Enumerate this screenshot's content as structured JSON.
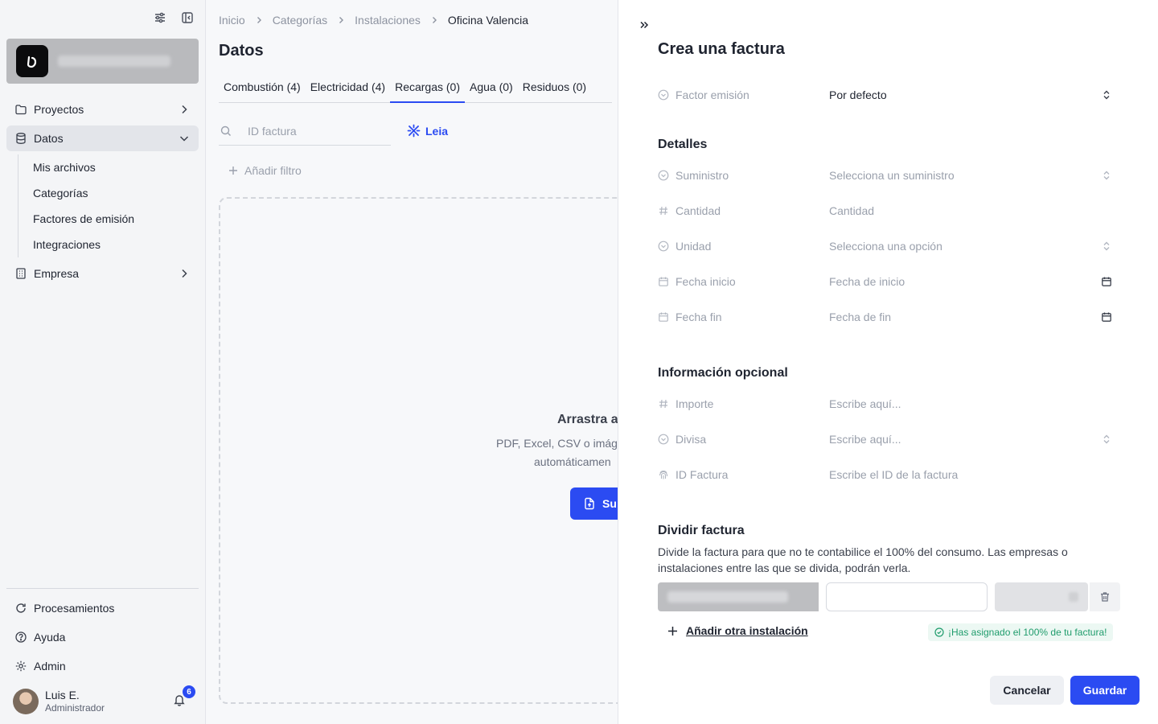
{
  "sidebar": {
    "nav": [
      {
        "label": "Proyectos",
        "icon": "folder-icon"
      },
      {
        "label": "Datos",
        "icon": "database-icon"
      },
      {
        "label": "Empresa",
        "icon": "building-icon"
      }
    ],
    "datos_sub": [
      "Mis archivos",
      "Categorías",
      "Factores de emisión",
      "Integraciones"
    ],
    "bottom": [
      {
        "label": "Procesamientos",
        "icon": "refresh-icon"
      },
      {
        "label": "Ayuda",
        "icon": "help-icon"
      },
      {
        "label": "Admin",
        "icon": "gear-icon"
      }
    ],
    "user": {
      "name": "Luis E.",
      "role": "Administrador",
      "notifications": "6"
    }
  },
  "main": {
    "breadcrumb": [
      "Inicio",
      "Categorías",
      "Instalaciones",
      "Oficina Valencia"
    ],
    "title": "Datos",
    "tabs": [
      "Combustión (4)",
      "Electricidad (4)",
      "Recargas (0)",
      "Agua (0)",
      "Residuos (0)"
    ],
    "active_tab": 2,
    "search_placeholder": "ID factura",
    "leia_label": "Leia",
    "add_filter": "Añadir filtro",
    "dropzone": {
      "title": "Arrastra a",
      "line1": "PDF, Excel, CSV o imág",
      "line2": "automáticamen",
      "button": "Su"
    }
  },
  "drawer": {
    "title": "Crea una factura",
    "factor": {
      "label": "Factor emisión",
      "value": "Por defecto"
    },
    "detalles_title": "Detalles",
    "detalles": [
      {
        "label": "Suministro",
        "placeholder": "Selecciona un suministro"
      },
      {
        "label": "Cantidad",
        "placeholder": "Cantidad"
      },
      {
        "label": "Unidad",
        "placeholder": "Selecciona una opción"
      },
      {
        "label": "Fecha inicio",
        "placeholder": "Fecha de inicio"
      },
      {
        "label": "Fecha fin",
        "placeholder": "Fecha de fin"
      }
    ],
    "opcional_title": "Información opcional",
    "opcional": [
      {
        "label": "Importe",
        "placeholder": "Escribe aquí..."
      },
      {
        "label": "Divisa",
        "placeholder": "Escribe aquí..."
      },
      {
        "label": "ID Factura",
        "placeholder": "Escribe el ID de la factura"
      }
    ],
    "dividir_title": "Dividir factura",
    "dividir_desc": "Divide la factura para que no te contabilice el 100% del consumo. Las empresas o instalaciones entre las que se divida, podrán verla.",
    "add_instalacion": "Añadir otra instalación",
    "assigned_msg": "¡Has asignado el 100% de tu factura!",
    "cancel": "Cancelar",
    "save": "Guardar"
  },
  "colors": {
    "accent": "#2b4bf2",
    "success": "#1f9c6c",
    "sidebar_bg": "#f4f5f7"
  }
}
